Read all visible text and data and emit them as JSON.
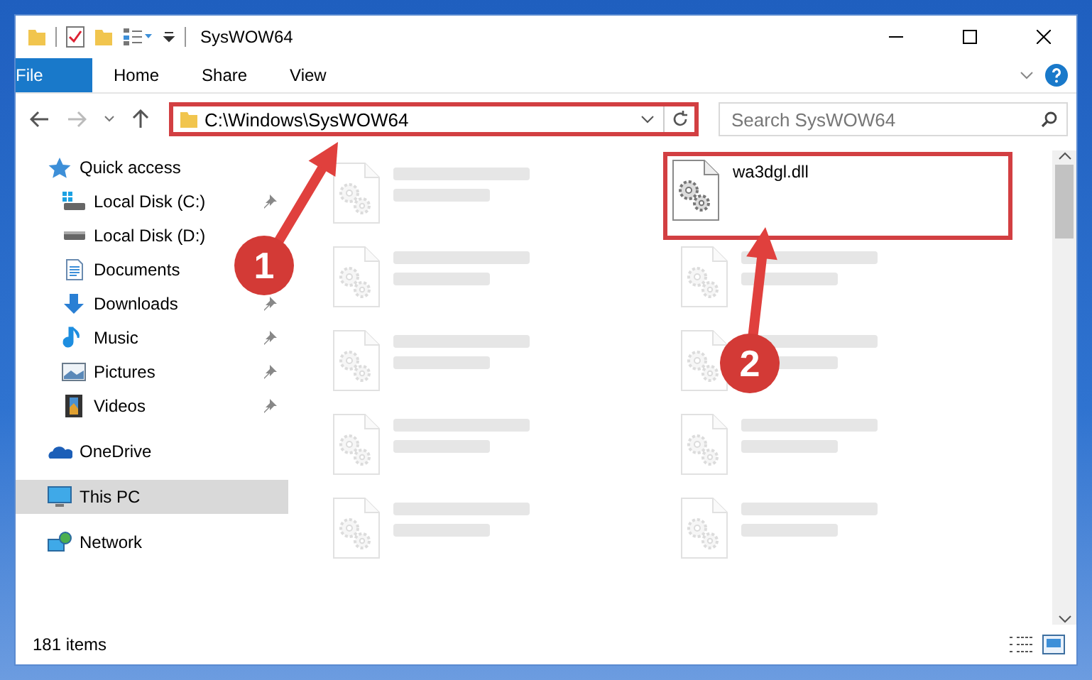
{
  "window": {
    "title": "SysWOW64"
  },
  "ribbon_tabs": [
    {
      "label": "File",
      "kind": "file"
    },
    {
      "label": "Home",
      "kind": "tab"
    },
    {
      "label": "Share",
      "kind": "tab"
    },
    {
      "label": "View",
      "kind": "tab"
    }
  ],
  "address": {
    "path": "C:\\Windows\\SysWOW64",
    "highlighted": true
  },
  "search": {
    "placeholder": "Search SysWOW64"
  },
  "sidebar": {
    "items": [
      {
        "label": "Quick access",
        "kind": "star",
        "selected": false,
        "children": [
          {
            "label": "Local Disk (C:)",
            "kind": "drive-c",
            "pinned": true,
            "selected": false
          },
          {
            "label": "Local Disk (D:)",
            "kind": "drive",
            "pinned": false,
            "selected": false
          },
          {
            "label": "Documents",
            "kind": "documents",
            "pinned": false,
            "selected": false
          },
          {
            "label": "Downloads",
            "kind": "downloads",
            "pinned": true,
            "selected": false
          },
          {
            "label": "Music",
            "kind": "music",
            "pinned": true,
            "selected": false
          },
          {
            "label": "Pictures",
            "kind": "pictures",
            "pinned": true,
            "selected": false
          },
          {
            "label": "Videos",
            "kind": "videos",
            "pinned": true,
            "selected": false
          }
        ]
      },
      {
        "label": "OneDrive",
        "kind": "cloud",
        "selected": false
      },
      {
        "label": "This PC",
        "kind": "pc",
        "selected": true
      },
      {
        "label": "Network",
        "kind": "network",
        "selected": false
      }
    ]
  },
  "files": [
    {
      "kind": "blurred"
    },
    {
      "kind": "file",
      "name": "wa3dgl.dll",
      "highlighted": true
    },
    {
      "kind": "blurred"
    },
    {
      "kind": "blurred"
    },
    {
      "kind": "blurred"
    },
    {
      "kind": "blurred"
    },
    {
      "kind": "blurred"
    },
    {
      "kind": "blurred"
    },
    {
      "kind": "blurred"
    },
    {
      "kind": "blurred"
    }
  ],
  "status_bar": {
    "item_count": "181 items"
  },
  "annotations": [
    {
      "number": "1"
    },
    {
      "number": "2"
    }
  ]
}
